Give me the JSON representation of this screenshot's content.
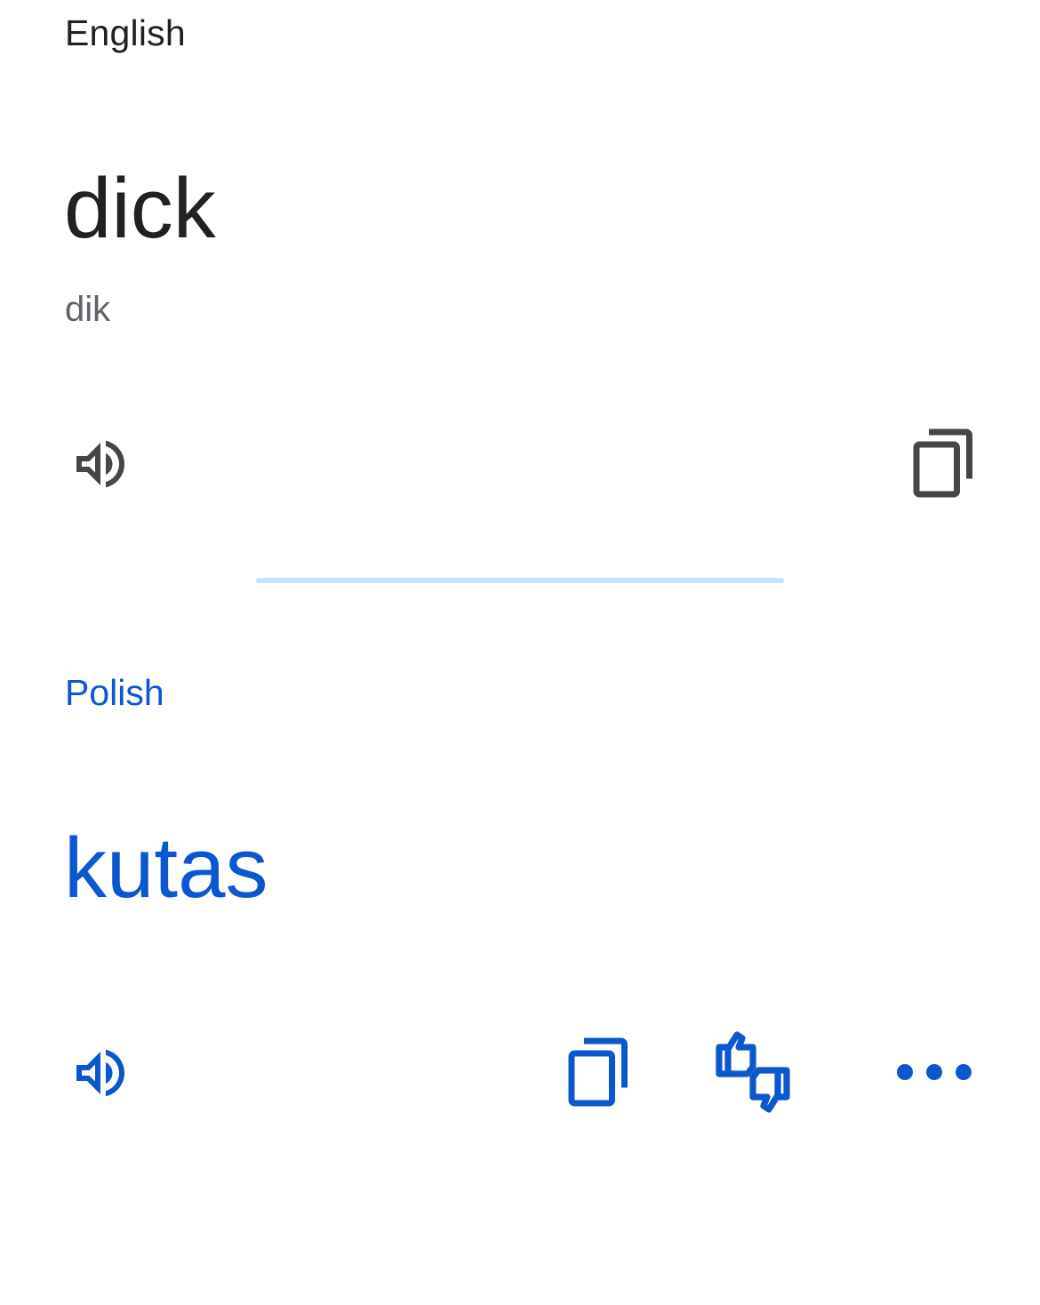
{
  "source": {
    "language": "English",
    "text": "dick",
    "transliteration": "dik",
    "icons": {
      "speaker": "speaker-icon",
      "copy": "copy-icon"
    }
  },
  "target": {
    "language": "Polish",
    "text": "kutas",
    "icons": {
      "speaker": "speaker-icon",
      "copy": "copy-icon",
      "feedback": "thumbs-up-down-icon",
      "more": "more-horizontal-icon"
    }
  },
  "colors": {
    "source_text": "#202124",
    "secondary_text": "#5f6368",
    "accent": "#0b57d0",
    "divider": "#c6e4f7",
    "background": "#ffffff"
  }
}
